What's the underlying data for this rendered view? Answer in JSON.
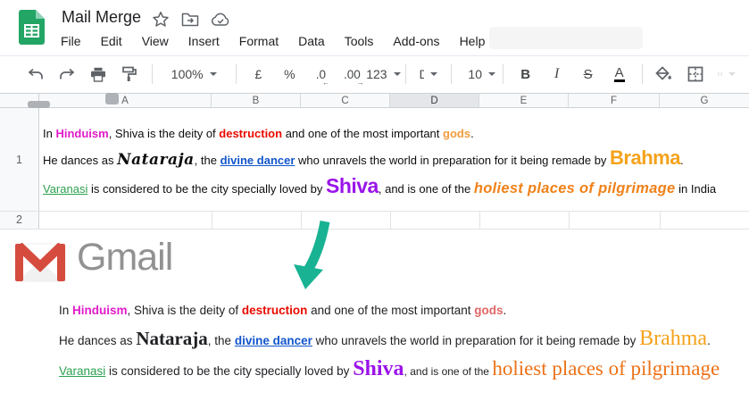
{
  "header": {
    "title": "Mail Merge",
    "menu": [
      "File",
      "Edit",
      "View",
      "Insert",
      "Format",
      "Data",
      "Tools",
      "Add-ons",
      "Help"
    ]
  },
  "toolbar": {
    "zoom": "100%",
    "currency": "£",
    "percent": "%",
    "decrease_decimal": ".0",
    "increase_decimal": ".00",
    "more_formats": "123",
    "font_name": "Default (Ari…",
    "font_size": "10",
    "bold": "B",
    "italic": "I",
    "strikethrough": "S",
    "text_color": "A"
  },
  "icons": {
    "dec_arrow": "←",
    "inc_arrow": "→"
  },
  "sheet": {
    "columns": [
      "A",
      "B",
      "C",
      "D",
      "E",
      "F",
      "G"
    ],
    "selected_column": "D",
    "row_numbers": [
      "1",
      "2"
    ],
    "cell_lines": [
      [
        {
          "t": "In ",
          "c": ""
        },
        {
          "t": "Hinduism",
          "c": "seg-magenta"
        },
        {
          "t": ", Shiva is the deity of ",
          "c": ""
        },
        {
          "t": "destruction",
          "c": "seg-red"
        },
        {
          "t": " and one of the most important ",
          "c": ""
        },
        {
          "t": "gods",
          "c": "seg-gods-sheet"
        },
        {
          "t": ".",
          "c": ""
        }
      ],
      [
        {
          "t": "He dances as ",
          "c": ""
        },
        {
          "t": "Nataraja",
          "c": "seg-script"
        },
        {
          "t": ", the ",
          "c": ""
        },
        {
          "t": "divine dancer",
          "c": "seg-link",
          "n": "divine-dancer-link",
          "i": true
        },
        {
          "t": " who unravels the world in preparation for it being remade by ",
          "c": ""
        },
        {
          "t": "Brahma",
          "c": "seg-brahma-sheet"
        },
        {
          "t": ".",
          "c": ""
        }
      ],
      [
        {
          "t": "Varanasi",
          "c": "seg-green-link",
          "n": "varanasi-link",
          "i": true
        },
        {
          "t": " is considered to be the city specially loved by ",
          "c": ""
        },
        {
          "t": "Shiva",
          "c": "seg-shiva-sheet"
        },
        {
          "t": ", and is one of the ",
          "c": ""
        },
        {
          "t": "holiest places of pilgrimage",
          "c": "seg-holiest-sheet"
        },
        {
          "t": " in India",
          "c": ""
        }
      ]
    ]
  },
  "gmail": {
    "logo_text": "Gmail",
    "lines": [
      [
        {
          "t": "In ",
          "c": ""
        },
        {
          "t": "Hinduism",
          "c": "seg-magenta"
        },
        {
          "t": ", Shiva is the deity of ",
          "c": ""
        },
        {
          "t": "destruction",
          "c": "seg-red"
        },
        {
          "t": " and one of the most important ",
          "c": ""
        },
        {
          "t": "gods",
          "c": "seg-gods-gmail"
        },
        {
          "t": ".",
          "c": ""
        }
      ],
      [
        {
          "t": "He dances as ",
          "c": ""
        },
        {
          "t": "Nataraja",
          "c": "seg-serif-bold"
        },
        {
          "t": ", the ",
          "c": ""
        },
        {
          "t": "divine dancer",
          "c": "seg-link",
          "n": "divine-dancer-link",
          "i": true
        },
        {
          "t": " who unravels the world in preparation for it being remade by ",
          "c": ""
        },
        {
          "t": "Brahma",
          "c": "seg-brahma-gmail"
        },
        {
          "t": ".",
          "c": ""
        }
      ],
      [
        {
          "t": "Varanasi",
          "c": "seg-green-link",
          "n": "varanasi-link",
          "i": true
        },
        {
          "t": " is considered to be the city specially loved by ",
          "c": ""
        },
        {
          "t": "Shiva",
          "c": "seg-shiva-gmail"
        },
        {
          "t": ", and is one of the ",
          "c": "seg-small"
        },
        {
          "t": "holiest places of pilgrimage",
          "c": "seg-holiest-gmail"
        }
      ]
    ]
  },
  "colors": {
    "sheets_green": "#23a566",
    "gmail_red": "#d54c3f",
    "arrow_teal": "#19b394",
    "link_blue": "#1155cc",
    "magenta": "#e01cc8",
    "red": "#e90b00",
    "orange": "#f5a21b",
    "purple": "#9b14ea",
    "green_link": "#2ba14e",
    "pilgrimage_orange": "#ed7117"
  }
}
